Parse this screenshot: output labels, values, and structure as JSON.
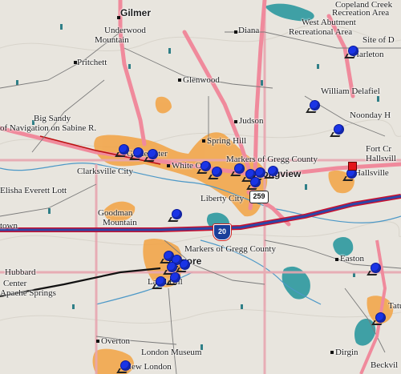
{
  "map": {
    "places": {
      "gilmer": "Gilmer",
      "underwood": "Underwood",
      "mountain1": "Mountain",
      "pritchett": "Pritchett",
      "diana": "Diana",
      "glenwood": "Glenwood",
      "big_sandy": "Big Sandy",
      "navigation": "of Navigation on Sabine R.",
      "judson": "Judson",
      "spring_hill": "Spring Hill",
      "gladewater": "Gladewater",
      "clarksville": "Clarksville City",
      "white_oak": "White Oak",
      "markers1": "Markers of Gregg County",
      "longview": "Longview",
      "liberty_city": "Liberty City",
      "elisha": "Elisha Everett Lott",
      "kilgore_town": "town",
      "goodman": "Goodman",
      "mountain2": "Mountain",
      "markers2": "Markers of Gregg County",
      "kilgore": "Kilgore",
      "hubbard": "Hubbard",
      "center": "Center",
      "apache": "Apache Springs",
      "laird_hill": "Laird Hill",
      "easton": "Easton",
      "overton": "Overton",
      "london_museum": "London Museum",
      "new_london": "New London",
      "dirgin": "Dirgin",
      "beckville": "Beckvil",
      "copeland": "Copeland Creek",
      "recreation": "Recreation Area",
      "west_abutment": "West Abutment",
      "recreational_area": "Recreational Area",
      "site_of": "Site of D",
      "harleton": "Harleton",
      "delafield": "William Delafiel",
      "noonday": "Noonday H",
      "fort_cr": "Fort Cr",
      "hallsville_park": "Hallsvill",
      "hallsville": "Hallsville",
      "tatum": "Tatum"
    },
    "shields": {
      "interstate": "20",
      "us_route": "259"
    }
  }
}
